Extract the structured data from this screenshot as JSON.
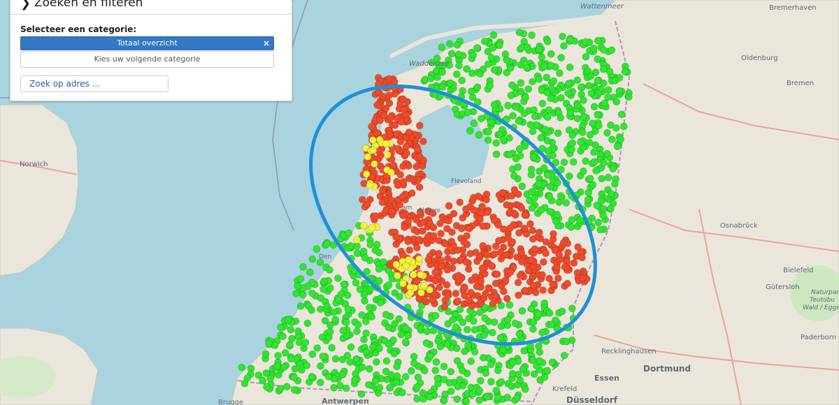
{
  "panel": {
    "title": "Zoeken en filteren",
    "category_label": "Selecteer een categorie:",
    "selected_category": "Totaal overzicht",
    "remove_symbol": "×",
    "next_category": "Kies uw volgende categorie",
    "address_search": "Zoek op adres ..."
  },
  "map_labels": {
    "norwich": "Norwich",
    "waddenzee": "Waddenzee",
    "wattenmeer": "Wattenmeer",
    "bremerhaven": "Bremerhaven",
    "oldenburg": "Oldenburg",
    "bremen": "Bremen",
    "osnabruck": "Osnabrück",
    "bielefeld": "Bielefeld",
    "gutersloh": "Gütersloh",
    "paderborn": "Paderborn",
    "recklinghausen": "Recklinghausen",
    "dortmund": "Dortmund",
    "essen": "Essen",
    "dusseldorf": "Düsseldorf",
    "krefeld": "Krefeld",
    "antwerpen": "Antwerpen",
    "brugge": "Brugge",
    "almere": "Almere",
    "flevoland": "Flevoland",
    "den": "Den",
    "am": "am",
    "naturpark": "Naturpark",
    "teutoburger": "Teutobu",
    "wald": "Wald / Egge"
  },
  "colors": {
    "sea": "#a9d3df",
    "land": "#ebe6dc",
    "green_marker": "#2ee62e",
    "red_marker": "#f04a2a",
    "yellow_marker": "#f2f23a",
    "ellipse": "#1e90d6",
    "button_blue": "#3278c2"
  }
}
